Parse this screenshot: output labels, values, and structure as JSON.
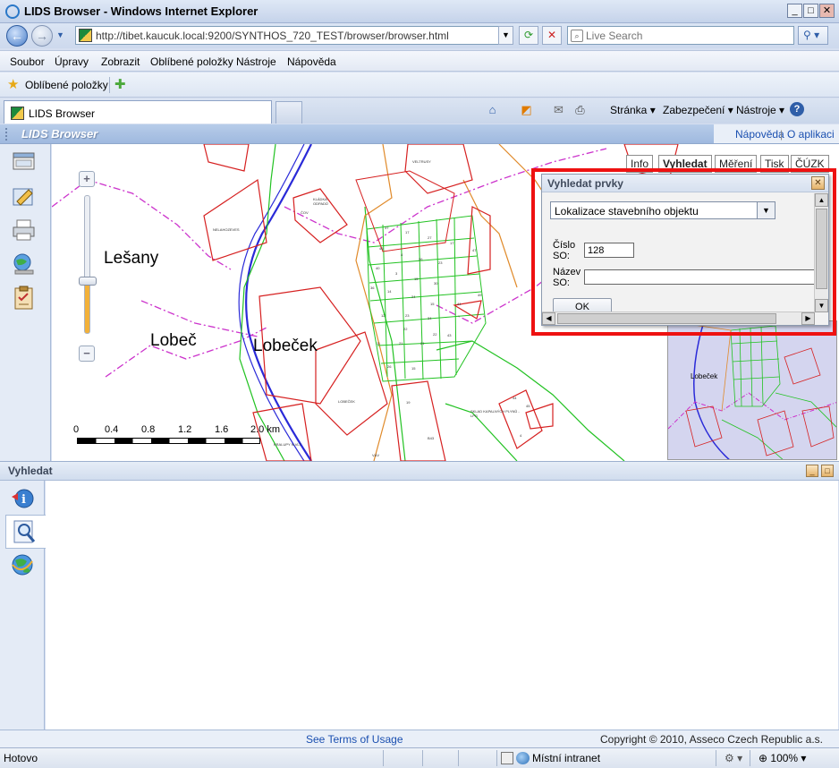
{
  "window": {
    "title": "LIDS Browser - Windows Internet Explorer",
    "minimize": "_",
    "maximize": "□",
    "close": "✕"
  },
  "addressbar": {
    "url": "http://tibet.kaucuk.local:9200/SYNTHOS_720_TEST/browser/browser.html",
    "back": "←",
    "forward": "→",
    "refresh": "⟳",
    "stop": "✕"
  },
  "search": {
    "placeholder": "Live Search",
    "go_icon": "⚲"
  },
  "menu": {
    "items": [
      "Soubor",
      "Úpravy",
      "Zobrazit",
      "Oblíbené položky",
      "Nástroje",
      "Nápověda"
    ]
  },
  "favorites": {
    "label": "Oblíbené položky"
  },
  "tabs": {
    "active_label": "LIDS Browser"
  },
  "commandbar": {
    "page": "Stránka",
    "security": "Zabezpečení",
    "tools": "Nástroje",
    "help_icon": "?"
  },
  "app": {
    "title": "LIDS Browser",
    "help_link": "Nápověda",
    "separator": "|",
    "about_link": "O aplikaci"
  },
  "map": {
    "places": [
      "Lešany",
      "Lobeč",
      "Lobeček"
    ],
    "zoom_in": "+",
    "zoom_out": "−",
    "zoom_level": 0.38,
    "scale_ticks": [
      "0",
      "0.4",
      "0.8",
      "1.2",
      "1.6",
      "2.0 km"
    ],
    "tabs": [
      "Info",
      "Vyhledat",
      "Měření",
      "Tisk",
      "ČÚZK"
    ],
    "active_tab": "Vyhledat",
    "small_labels": [
      "VELTRUSY",
      "KLÁDKA ODPADŮ",
      "ČOV",
      "NELAHOZEVES",
      "LOBEČEK",
      "SKLAD KAPALNÝCH PLYNŮ - LPG",
      "KRALUPY N.VLT.",
      "VÁV",
      "B43"
    ],
    "overview_label": "Lobeček"
  },
  "dialog": {
    "title": "Vyhledat prvky",
    "close": "✕",
    "select_value": "Lokalizace stavebního objektu",
    "field1_label": "Číslo SO:",
    "field1_value": "128",
    "field2_label": "Název SO:",
    "field2_value": "",
    "ok": "OK"
  },
  "panel": {
    "title": "Vyhledat",
    "btn_minimize": "_",
    "btn_restore": "□"
  },
  "footer": {
    "terms": "See Terms of Usage",
    "copyright": "Copyright © 2010, Asseco Czech Republic a.s."
  },
  "status": {
    "text": "Hotovo",
    "zone": "Místní intranet",
    "zoom": "100%"
  },
  "colors": {
    "highlight": "#ee1111",
    "link": "#1a4fb0",
    "map_red": "#d62020",
    "map_green": "#22c222",
    "map_blue": "#2a2ad8",
    "map_magenta": "#cc33cc",
    "map_orange": "#e08a2a"
  }
}
